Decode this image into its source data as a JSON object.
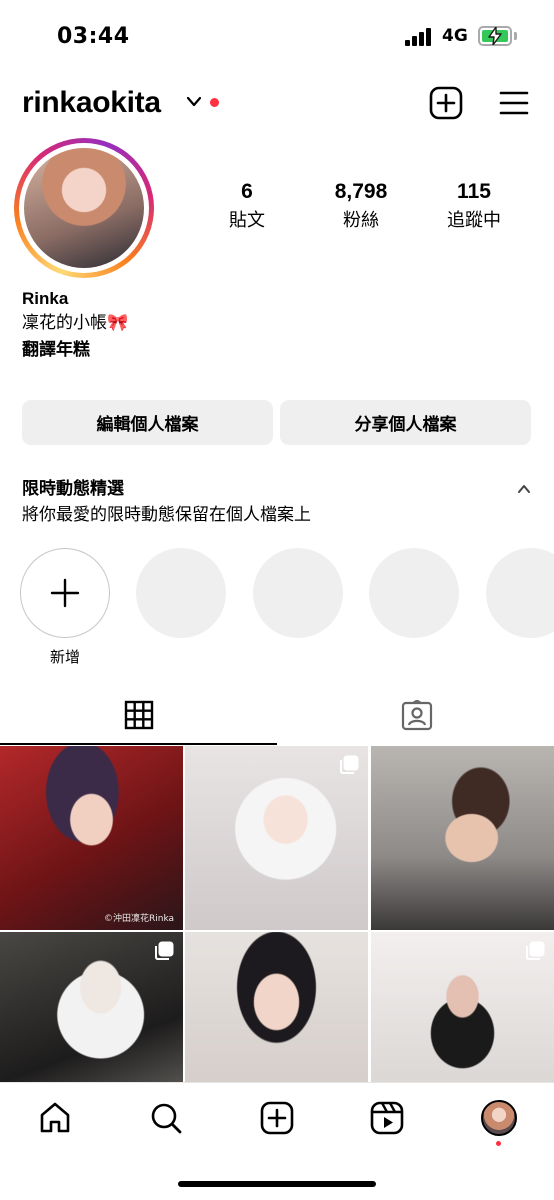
{
  "status_bar": {
    "time": "03:44",
    "network": "4G"
  },
  "header": {
    "username": "rinkaokita"
  },
  "profile": {
    "stats": [
      {
        "count": "6",
        "label": "貼文"
      },
      {
        "count": "8,798",
        "label": "粉絲"
      },
      {
        "count": "115",
        "label": "追蹤中"
      }
    ],
    "display_name": "Rinka",
    "bio_line1": "凜花的小帳🎀",
    "bio_line2": "翻譯年糕"
  },
  "buttons": {
    "edit_profile": "編輯個人檔案",
    "share_profile": "分享個人檔案"
  },
  "highlights": {
    "title": "限時動態精選",
    "subtitle": "將你最愛的限時動態保留在個人檔案上",
    "new_label": "新增"
  },
  "posts": [
    {
      "multi": false
    },
    {
      "multi": true
    },
    {
      "multi": false
    },
    {
      "multi": true
    },
    {
      "multi": false
    },
    {
      "multi": true
    }
  ],
  "post_watermark": "©沖田凜花Rinka",
  "colors": {
    "accent_red": "#ff3040",
    "button_bg": "#efefef",
    "battery": "#34c759"
  },
  "icons": {
    "header": [
      "new-post-icon",
      "menu-icon"
    ],
    "tabs": [
      "grid-icon",
      "tagged-icon"
    ],
    "nav": [
      "home-icon",
      "search-icon",
      "create-icon",
      "reels-icon",
      "profile-avatar"
    ]
  }
}
